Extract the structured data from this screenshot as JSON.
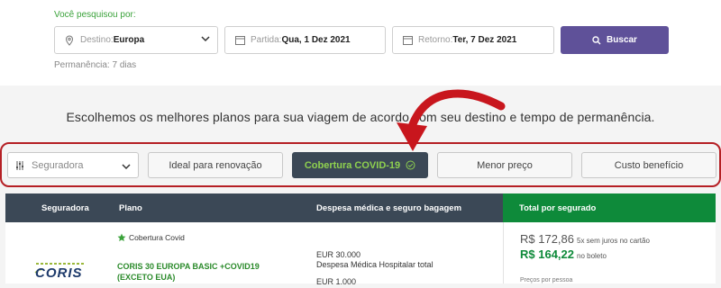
{
  "search": {
    "searched_label": "Você pesquisou por:",
    "destination_label": "Destino:",
    "destination_value": "Europa",
    "departure_label": "Partida:",
    "departure_value": "Qua, 1 Dez 2021",
    "return_label": "Retorno:",
    "return_value": "Ter, 7 Dez 2021",
    "search_button": "Buscar",
    "stay_text": "Permanência: 7 dias"
  },
  "headline": "Escolhemos os melhores planos para sua viagem de acordo com seu destino e tempo de permanência.",
  "filters": {
    "insurer_placeholder": "Seguradora",
    "buttons": [
      "Ideal para renovação",
      "Cobertura COVID-19",
      "Menor preço",
      "Custo benefício"
    ],
    "active": "Cobertura COVID-19"
  },
  "table": {
    "headers": [
      "Seguradora",
      "Plano",
      "Despesa médica e seguro bagagem",
      "Total por segurado"
    ],
    "rows": [
      {
        "logo_text": "CORIS",
        "covid_tag": "Cobertura Covid",
        "plan_name": "CORIS 30 EUROPA BASIC +COVID19 (EXCETO EUA)",
        "expense1_value": "EUR 30.000",
        "expense1_label": "Despesa Médica Hospitalar total",
        "expense2_value": "EUR 1.000",
        "price_card": "R$ 172,86",
        "price_card_note": "5x sem juros no cartão",
        "price_boleto": "R$ 164,22",
        "price_boleto_note": "no boleto",
        "per_person": "Preços por pessoa"
      }
    ]
  },
  "colors": {
    "accent": "#5f5199",
    "highlight_border": "#b51f24",
    "header_dark": "#3b4856",
    "total_green": "#0e8a3a",
    "plan_green": "#2a8a2a"
  }
}
